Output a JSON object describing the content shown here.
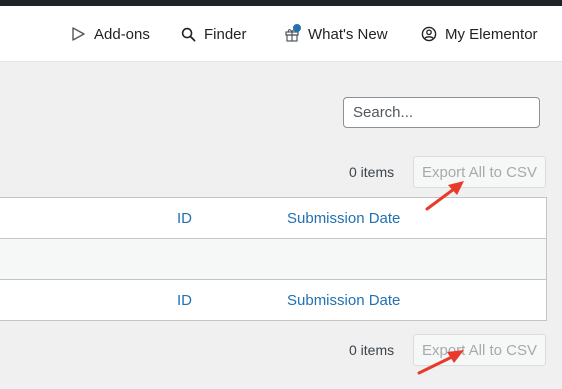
{
  "header": {
    "nav": [
      {
        "label": "Add-ons",
        "icon": "addons-icon"
      },
      {
        "label": "Finder",
        "icon": "search-icon"
      },
      {
        "label": "What's New",
        "icon": "gift-icon",
        "has_notification": true
      },
      {
        "label": "My Elementor",
        "icon": "user-circle-icon"
      }
    ]
  },
  "search": {
    "placeholder": "Search...",
    "value": ""
  },
  "pagination_top": {
    "count_text": "0 items",
    "export_label": "Export All to CSV"
  },
  "table": {
    "columns": [
      "ID",
      "Submission Date"
    ],
    "footer_columns": [
      "ID",
      "Submission Date"
    ]
  },
  "pagination_bottom": {
    "count_text": "0 items",
    "export_label": "Export All to CSV"
  },
  "colors": {
    "accent": "#2271b1",
    "annotation_arrow": "#e8392b"
  }
}
